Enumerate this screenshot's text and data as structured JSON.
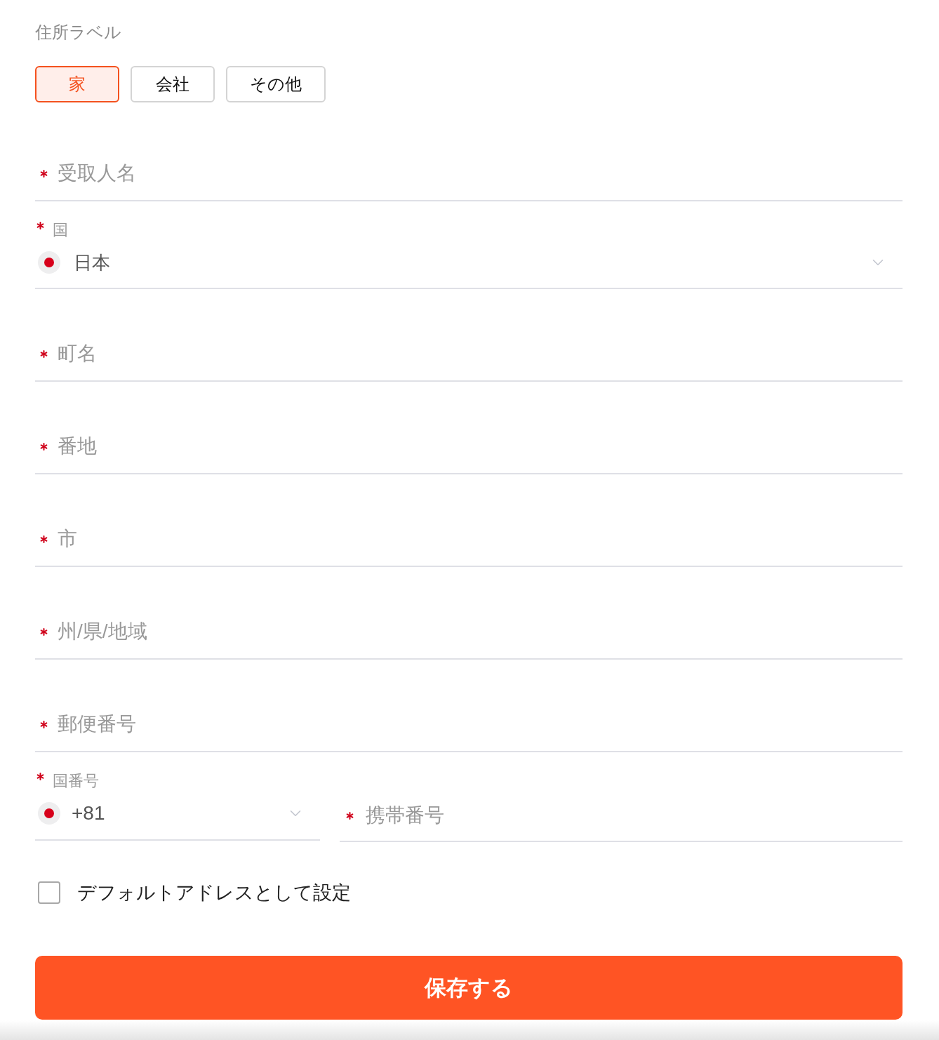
{
  "address_label": {
    "label": "住所ラベル",
    "options": [
      {
        "label": "家",
        "selected": true
      },
      {
        "label": "会社",
        "selected": false
      },
      {
        "label": "その他",
        "selected": false
      }
    ]
  },
  "fields": [
    {
      "kind": "text",
      "required": true,
      "placeholder": "受取人名"
    },
    {
      "kind": "select",
      "required": true,
      "label": "国",
      "value": "日本"
    },
    {
      "kind": "text",
      "required": true,
      "placeholder": "町名"
    },
    {
      "kind": "text",
      "required": true,
      "placeholder": "番地"
    },
    {
      "kind": "text",
      "required": true,
      "placeholder": "市"
    },
    {
      "kind": "text",
      "required": true,
      "placeholder": "州/県/地域"
    },
    {
      "kind": "text",
      "required": true,
      "placeholder": "郵便番号"
    }
  ],
  "phone": {
    "code": {
      "label": "国番号",
      "value": "+81",
      "required": true
    },
    "number": {
      "placeholder": "携帯番号",
      "required": true
    }
  },
  "default_checkbox": {
    "label": "デフォルトアドレスとして設定",
    "checked": false
  },
  "save_button": {
    "label": "保存する"
  }
}
